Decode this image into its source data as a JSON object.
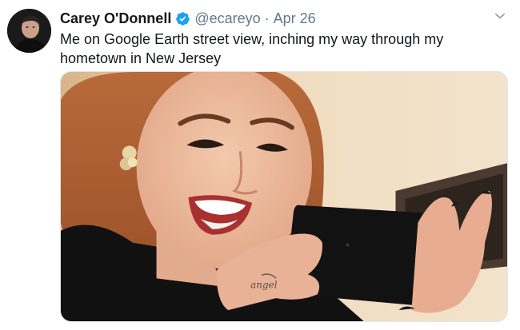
{
  "tweet": {
    "author_name": "Carey O'Donnell",
    "verified_icon": "verified-badge-icon",
    "handle": "@ecareyo",
    "separator": "·",
    "date": "Apr 26",
    "text": "Me on Google Earth street view, inching my way through my hometown in New Jersey",
    "caret_icon": "chevron-down-icon",
    "media": {
      "image_icon": "tweet-photo",
      "tattoo_text": "angel"
    }
  },
  "colors": {
    "text_primary": "#14171a",
    "text_secondary": "#657786",
    "verified_blue": "#1da1f2"
  }
}
